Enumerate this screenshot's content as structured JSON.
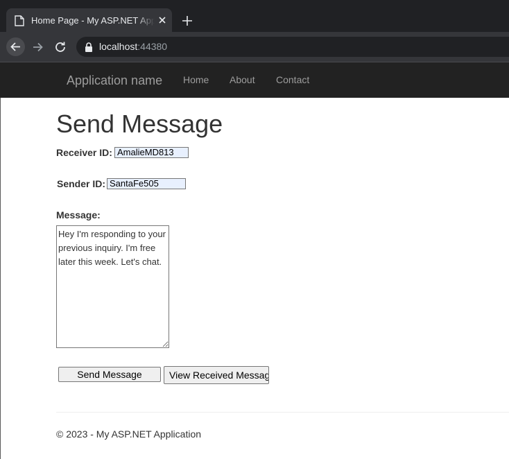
{
  "browser": {
    "tab_title": "Home Page - My ASP.NET Application",
    "address_host": "localhost",
    "address_port": ":44380",
    "icons": [
      "page-icon",
      "close-icon",
      "plus-icon",
      "back-arrow-icon",
      "forward-arrow-icon",
      "reload-icon",
      "lock-icon"
    ]
  },
  "navbar": {
    "brand": "Application name",
    "links": [
      "Home",
      "About",
      "Contact"
    ]
  },
  "page": {
    "heading": "Send Message",
    "receiver_label": "Receiver ID:",
    "receiver_value": "AmalieMD813",
    "sender_label": "Sender ID:",
    "sender_value": "SantaFe505",
    "message_label": "Message:",
    "message_value": "Hey I'm responding to your previous inquiry. I'm free later this week. Let's chat.",
    "send_button": "Send Message",
    "view_button": "View Received Messages"
  },
  "footer": {
    "text": "© 2023 - My ASP.NET Application"
  }
}
